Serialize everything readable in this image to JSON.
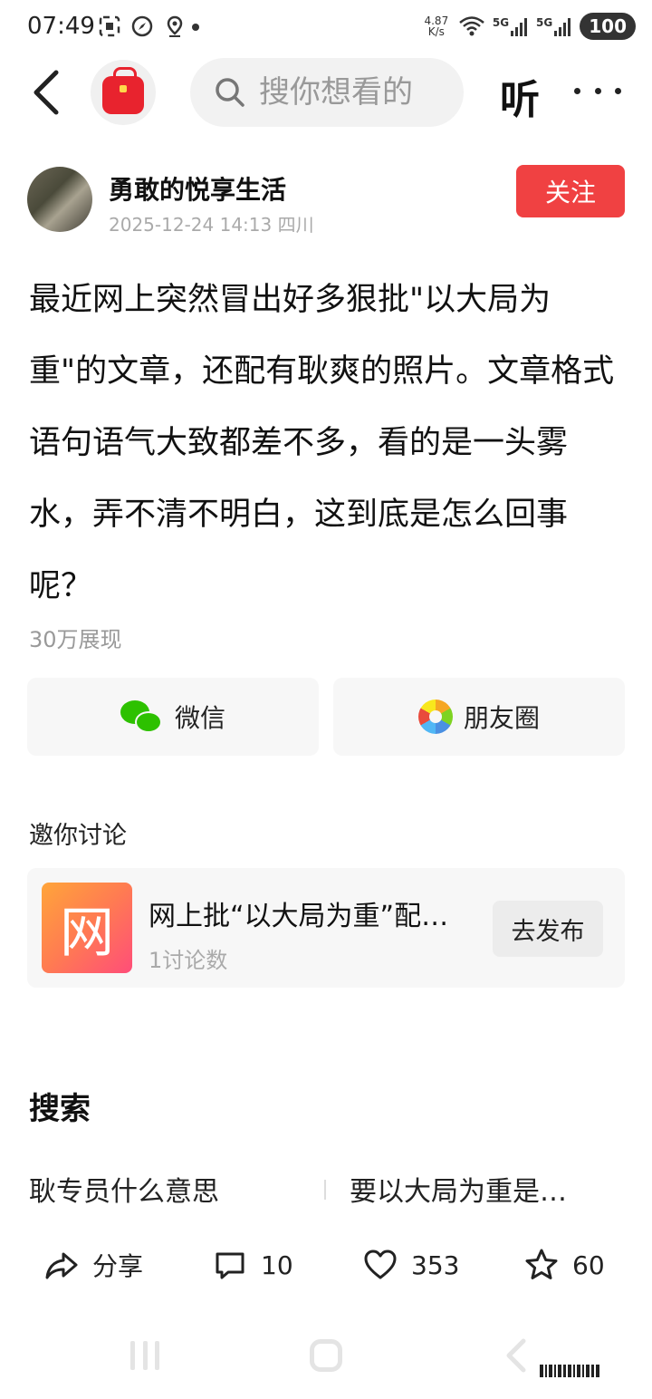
{
  "status_bar": {
    "time": "07:49",
    "net_speed_value": "4.87",
    "net_speed_unit": "K/s",
    "signal_1": "5G",
    "signal_2": "5G",
    "battery": "100"
  },
  "nav": {
    "search_placeholder": "搜你想看的",
    "listen_label": "听"
  },
  "author": {
    "name": "勇敢的悦享生活",
    "datetime": "2025-12-24 14:13",
    "location": "四川",
    "follow_label": "关注"
  },
  "post": {
    "body": "最近网上突然冒出好多狠批\"以大局为重\"的文章，还配有耿爽的照片。文章格式语句语气大致都差不多，看的是一头雾水，弄不清不明白，这到底是怎么回事呢？",
    "views": "30万展现"
  },
  "share": {
    "wechat_label": "微信",
    "moments_label": "朋友圈"
  },
  "discuss": {
    "section_title": "邀你讨论",
    "thumb_char": "网",
    "topic": "网上批“以大局为重”配…",
    "count": "1讨论数",
    "publish_label": "去发布"
  },
  "search_section": {
    "title": "搜索",
    "suggestions": [
      "耿专员什么意思",
      "要以大局为重是…"
    ]
  },
  "actions": {
    "share_label": "分享",
    "comments": "10",
    "likes": "353",
    "favorites": "60"
  },
  "colors": {
    "accent_red": "#f04142",
    "wechat_green": "#2dc100"
  }
}
